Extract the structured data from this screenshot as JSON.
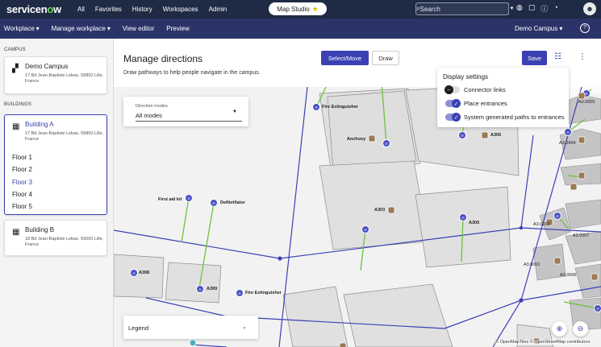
{
  "topbar": {
    "brand_text": "servicen",
    "brand_o": "o",
    "brand_tail": "w",
    "nav": [
      "All",
      "Favorites",
      "History",
      "Workspaces",
      "Admin"
    ],
    "studio_label": "Map Studio",
    "search_placeholder": "Search",
    "avatar_initial": "☻"
  },
  "subbar": {
    "workplace": "Workplace",
    "manage": "Manage workplace",
    "view_editor": "View editor",
    "preview": "Preview",
    "campus": "Demo Campus"
  },
  "sidebar": {
    "campus_label": "CAMPUS",
    "buildings_label": "BUILDINGS",
    "campus": {
      "name": "Demo Campus",
      "address": "17 Bd Jean-Baptiste Lebas, 59800 Lille, France"
    },
    "building_a": {
      "name": "Building A",
      "address": "17 Bd Jean-Baptiste Lebas, 59800 Lille, France"
    },
    "floors": [
      "Floor 1",
      "Floor 2",
      "Floor 3",
      "Floor 4",
      "Floor 5"
    ],
    "active_floor": "Floor 3",
    "building_b": {
      "name": "Building B",
      "address": "18 Bd Jean-Baptiste Lebas, 59000 Lille, France"
    }
  },
  "main": {
    "title": "Manage directions",
    "subtitle": "Draw pathways to help people navigate in the campus.",
    "select_move": "Select/Move",
    "draw": "Draw",
    "save": "Save"
  },
  "direction_modes": {
    "label": "Direction modes",
    "value": "All modes"
  },
  "display_settings": {
    "title": "Display settings",
    "items": [
      {
        "label": "Connector links",
        "on": false
      },
      {
        "label": "Place entrances",
        "on": true
      },
      {
        "label": "System generated paths to entrances",
        "on": true
      }
    ]
  },
  "legend": {
    "label": "Legend"
  },
  "map_labels": {
    "fire_ext_1": "Fire Extinguisher",
    "anchovy": "Anchovy",
    "a306": "A306",
    "first_aid": "First aid kit",
    "defibrillator": "Defibrillator",
    "a303": "A303",
    "a305": "A305",
    "a398": "A398",
    "a399": "A399",
    "fire_ext_2": "Fire Extinguisher",
    "a30005": "A3.0005",
    "a30004": "A3.0004",
    "a30002": "A3.0002",
    "a30007": "A3.0007",
    "a30001": "A3.0001",
    "a30006": "A3.0006"
  },
  "attribution": "© OpenMapTiles © OpenStreetMap contributors",
  "colors": {
    "topbar": "#1f2a44",
    "subbar": "#2b3469",
    "accent": "#3b40b4",
    "path": "#6cc33a",
    "node": "#4a50c4"
  }
}
